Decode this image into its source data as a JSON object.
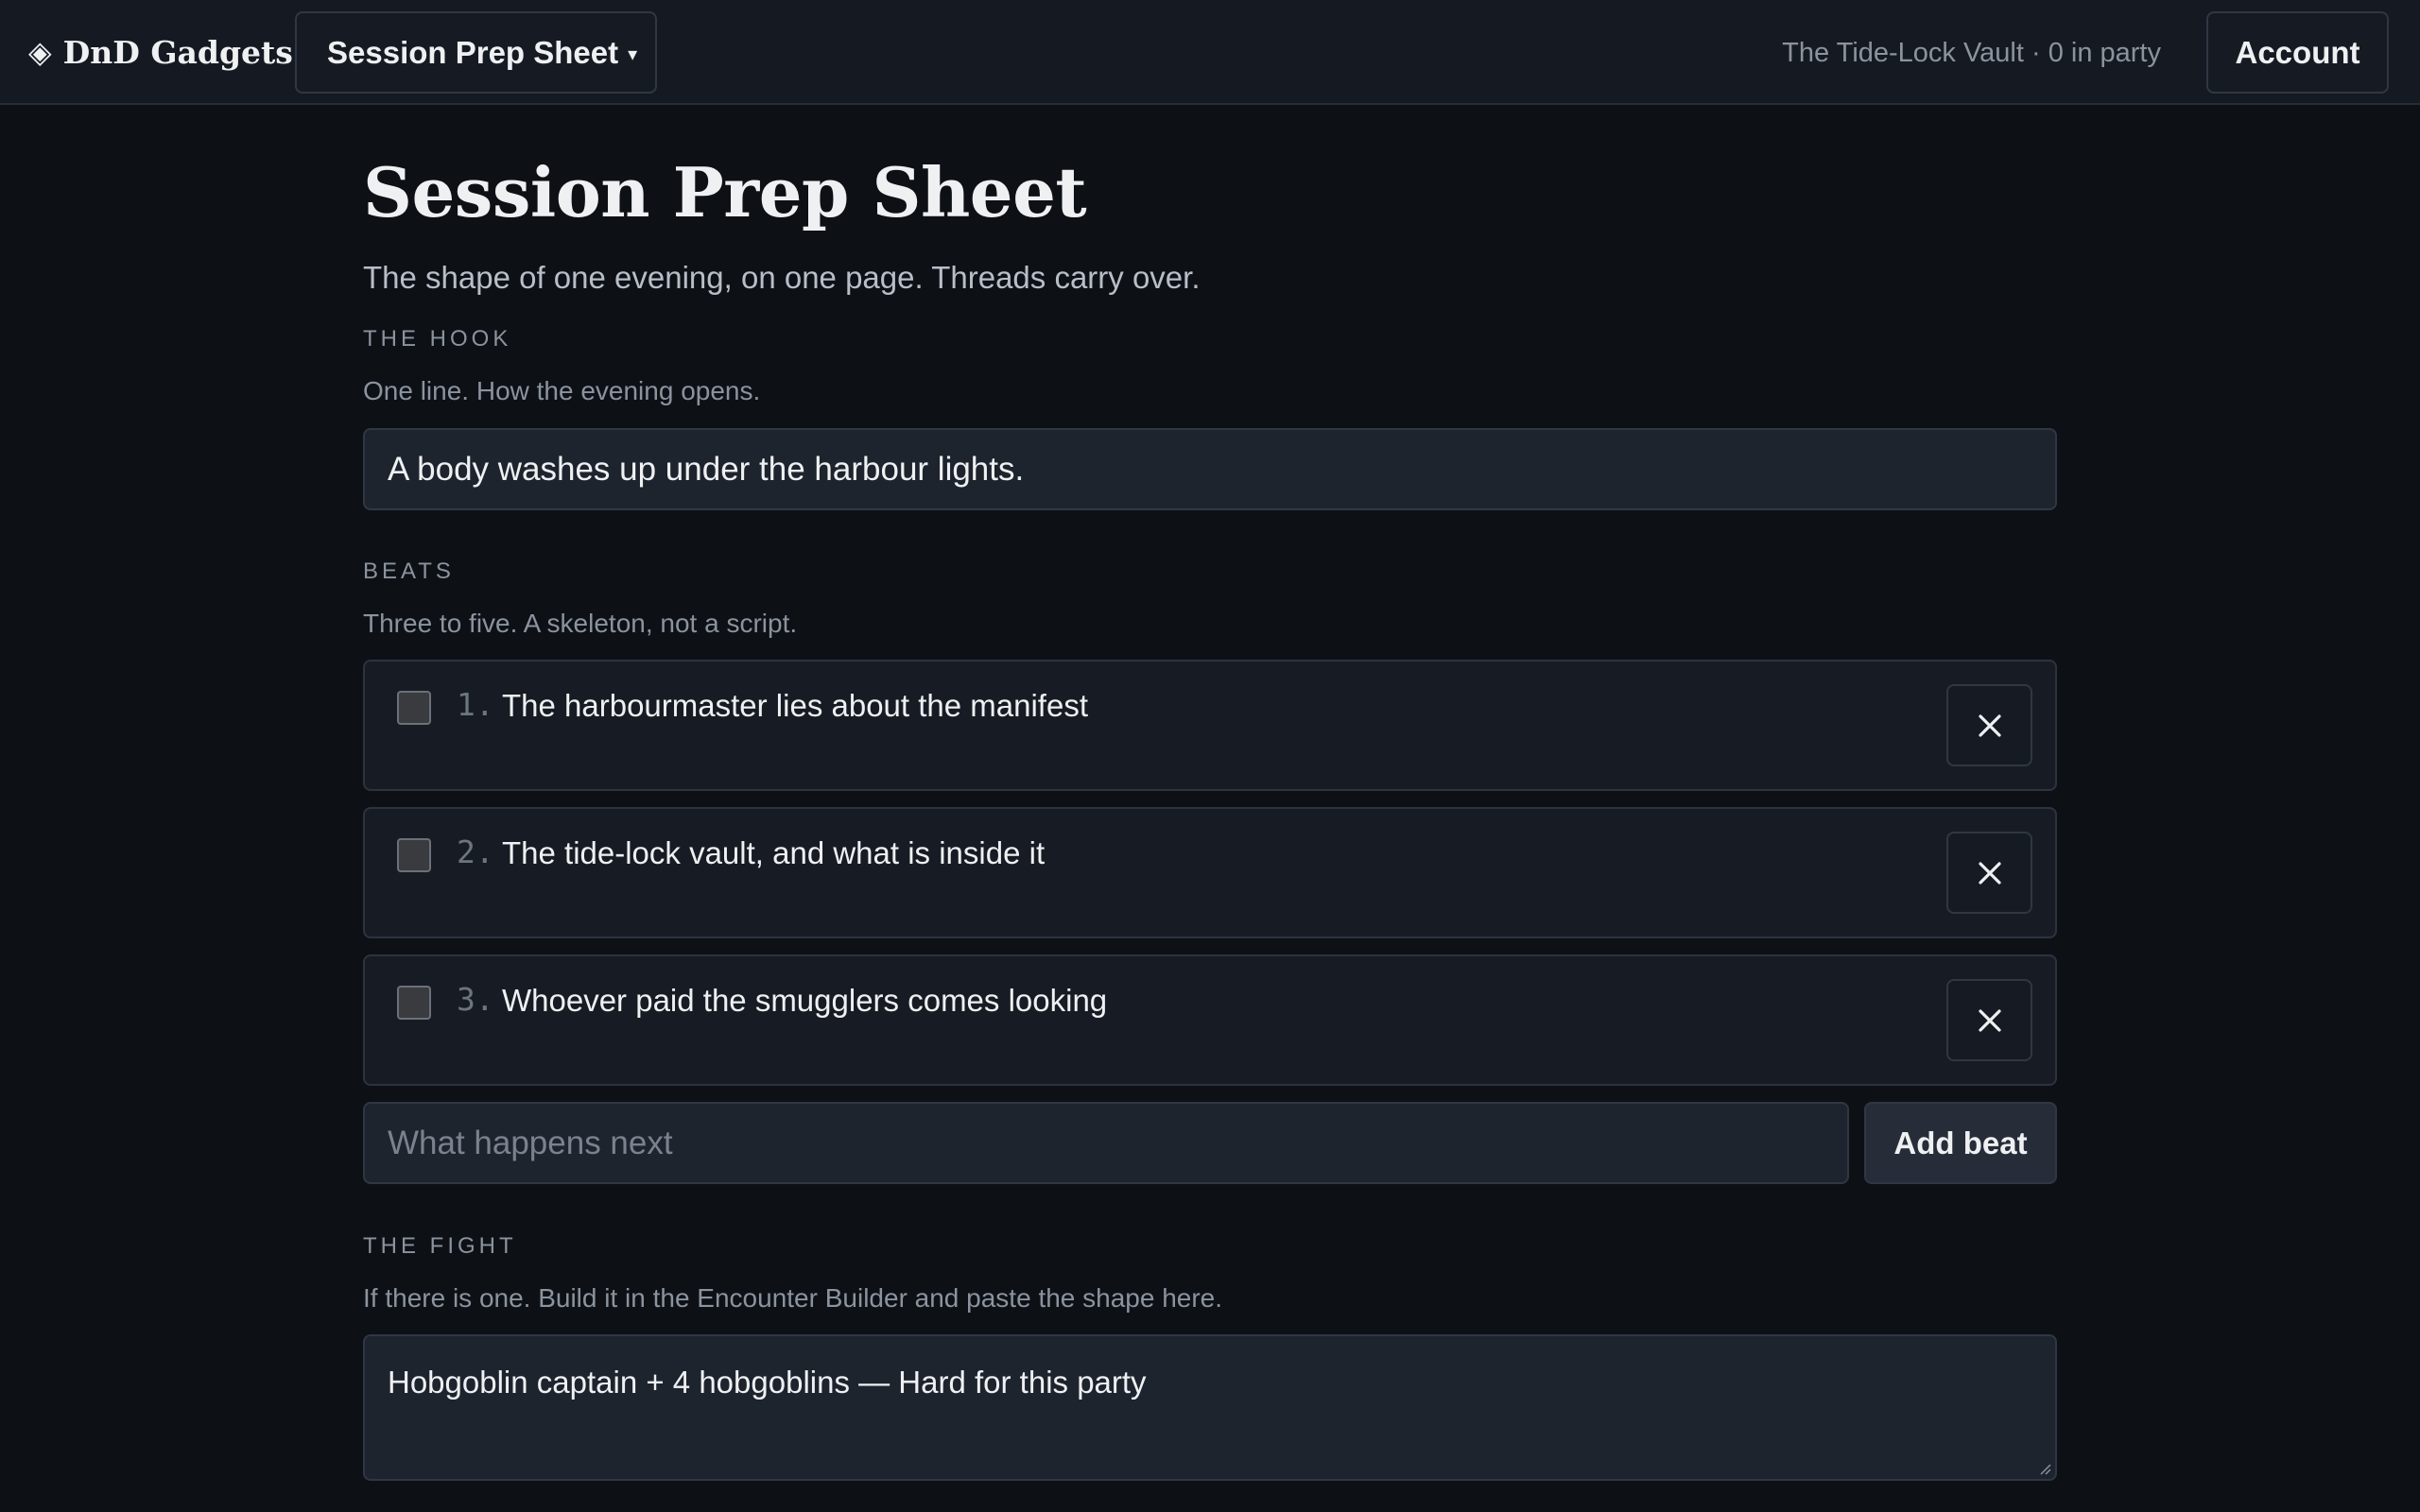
{
  "header": {
    "brand_icon": "◈",
    "brand_name": "DnD Gadgets",
    "tool_select": "Session Prep Sheet",
    "caret": "▾",
    "campaign_info": "The Tide-Lock Vault · 0 in party",
    "account_label": "Account"
  },
  "page": {
    "title": "Session Prep Sheet",
    "subtitle": "The shape of one evening, on one page. Threads carry over."
  },
  "hook": {
    "label": "THE HOOK",
    "help": "One line. How the evening opens.",
    "value": "A body washes up under the harbour lights."
  },
  "beats": {
    "label": "BEATS",
    "help": "Three to five. A skeleton, not a script.",
    "items": [
      {
        "num": "1.",
        "text": "The harbourmaster lies about the manifest",
        "checked": false
      },
      {
        "num": "2.",
        "text": "The tide-lock vault, and what is inside it",
        "checked": false
      },
      {
        "num": "3.",
        "text": "Whoever paid the smugglers comes looking",
        "checked": false
      }
    ],
    "new_placeholder": "What happens next",
    "add_label": "Add beat"
  },
  "fight": {
    "label": "THE FIGHT",
    "help": "If there is one. Build it in the Encounter Builder and paste the shape here.",
    "value": "Hobgoblin captain + 4 hobgoblins — Hard for this party"
  },
  "colors": {
    "background": "#0d1116",
    "topbar": "#151a22",
    "field": "#1e242e",
    "border": "#2f3744"
  }
}
